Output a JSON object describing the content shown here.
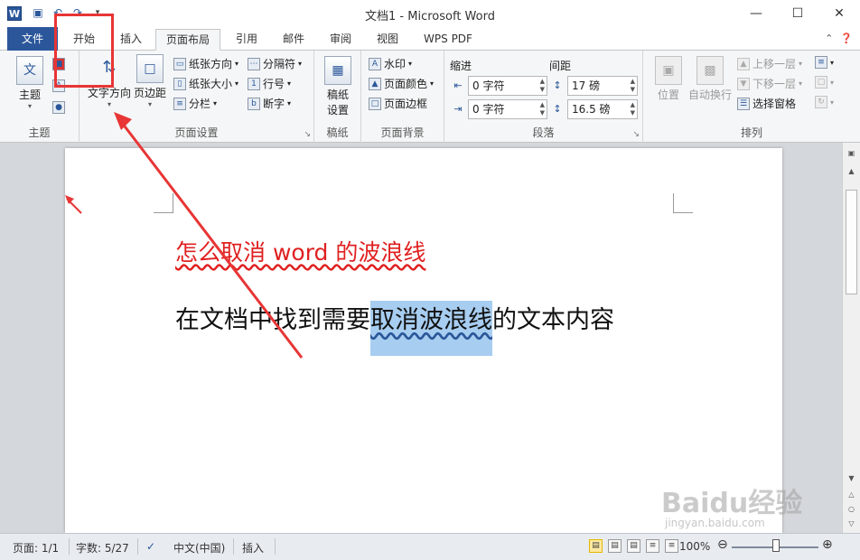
{
  "window": {
    "title": "文档1 - Microsoft Word",
    "app_icon_letter": "W"
  },
  "qat": {
    "save_icon": "save-icon",
    "undo_icon": "undo-icon",
    "redo_icon": "redo-icon"
  },
  "tabs": {
    "file": "文件",
    "items": [
      "开始",
      "插入",
      "页面布局",
      "引用",
      "邮件",
      "审阅",
      "视图",
      "WPS PDF"
    ],
    "active": "页面布局"
  },
  "ribbon": {
    "theme": {
      "label": "主题",
      "group": "主题"
    },
    "page_setup": {
      "group": "页面设置",
      "text_direction": "文字方向",
      "margins": "页边距",
      "orientation": "纸张方向",
      "size": "纸张大小",
      "columns": "分栏",
      "breaks": "分隔符",
      "line_numbers": "行号",
      "hyphenation": "断字"
    },
    "manuscript": {
      "group": "稿纸",
      "label1": "稿纸",
      "label2": "设置"
    },
    "page_background": {
      "group": "页面背景",
      "watermark": "水印",
      "page_color": "页面颜色",
      "page_borders": "页面边框"
    },
    "paragraph": {
      "group": "段落",
      "indent_label": "缩进",
      "spacing_label": "间距",
      "indent_left": "0 字符",
      "indent_right": "0 字符",
      "spacing_before": "17 磅",
      "spacing_after": "16.5 磅"
    },
    "arrange": {
      "group": "排列",
      "position": "位置",
      "wrap_text": "自动换行",
      "bring_forward": "上移一层",
      "send_backward": "下移一层",
      "selection_pane": "选择窗格"
    }
  },
  "document": {
    "title": "怎么取消 word 的波浪线",
    "body_before": "在文档中找到需要",
    "body_selected": "取消波浪线",
    "body_after": "的文本内容"
  },
  "statusbar": {
    "page": "页面: 1/1",
    "words": "字数: 5/27",
    "language": "中文(中国)",
    "mode": "插入",
    "zoom": "100%",
    "zoom_level_percent": 100
  },
  "watermark": {
    "brand": "Baidu经验",
    "url": "jingyan.baidu.com"
  },
  "colors": {
    "file_tab": "#2b579a",
    "annotation": "#e83535",
    "doc_title": "#e02020",
    "selection": "#a7cdf0"
  }
}
